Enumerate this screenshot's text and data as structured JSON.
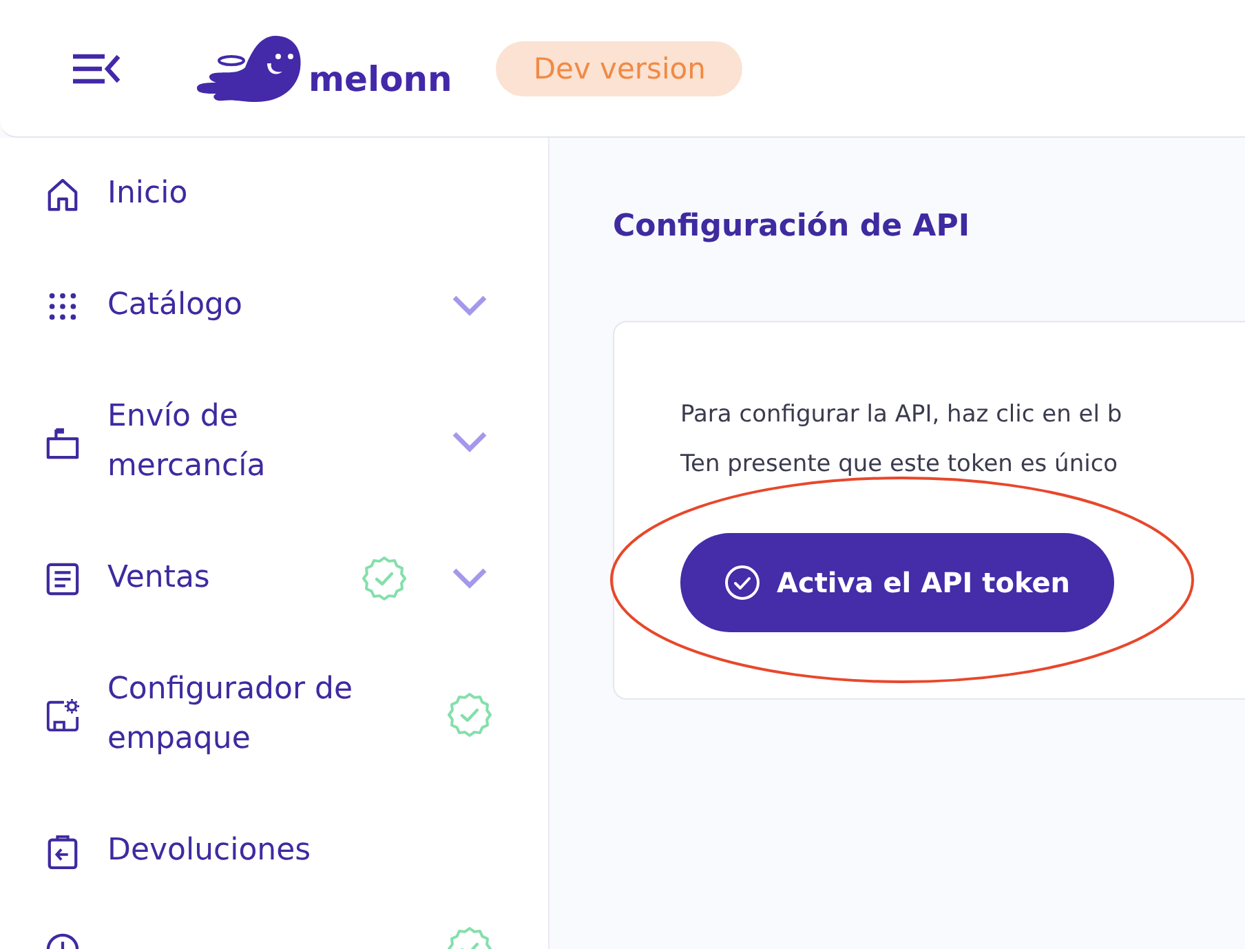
{
  "header": {
    "logo_text": "melonn",
    "badge": "Dev version"
  },
  "sidebar": {
    "items": [
      {
        "label": "Inicio",
        "verified": false
      },
      {
        "label": "Catálogo",
        "verified": false,
        "expanded": false
      },
      {
        "label": "Envío de mercancía",
        "verified": false,
        "expanded": false
      },
      {
        "label": "Ventas",
        "verified": true,
        "expanded": false
      },
      {
        "label": "Configurador de empaque",
        "verified": true
      },
      {
        "label": "Devoluciones",
        "verified": false
      },
      {
        "verified": true
      }
    ]
  },
  "main": {
    "title": "Configuración de API",
    "card": {
      "lines": [
        "Para configurar la API, haz clic en el b",
        "Ten presente que este token es único"
      ],
      "button": "Activa el API token"
    }
  }
}
